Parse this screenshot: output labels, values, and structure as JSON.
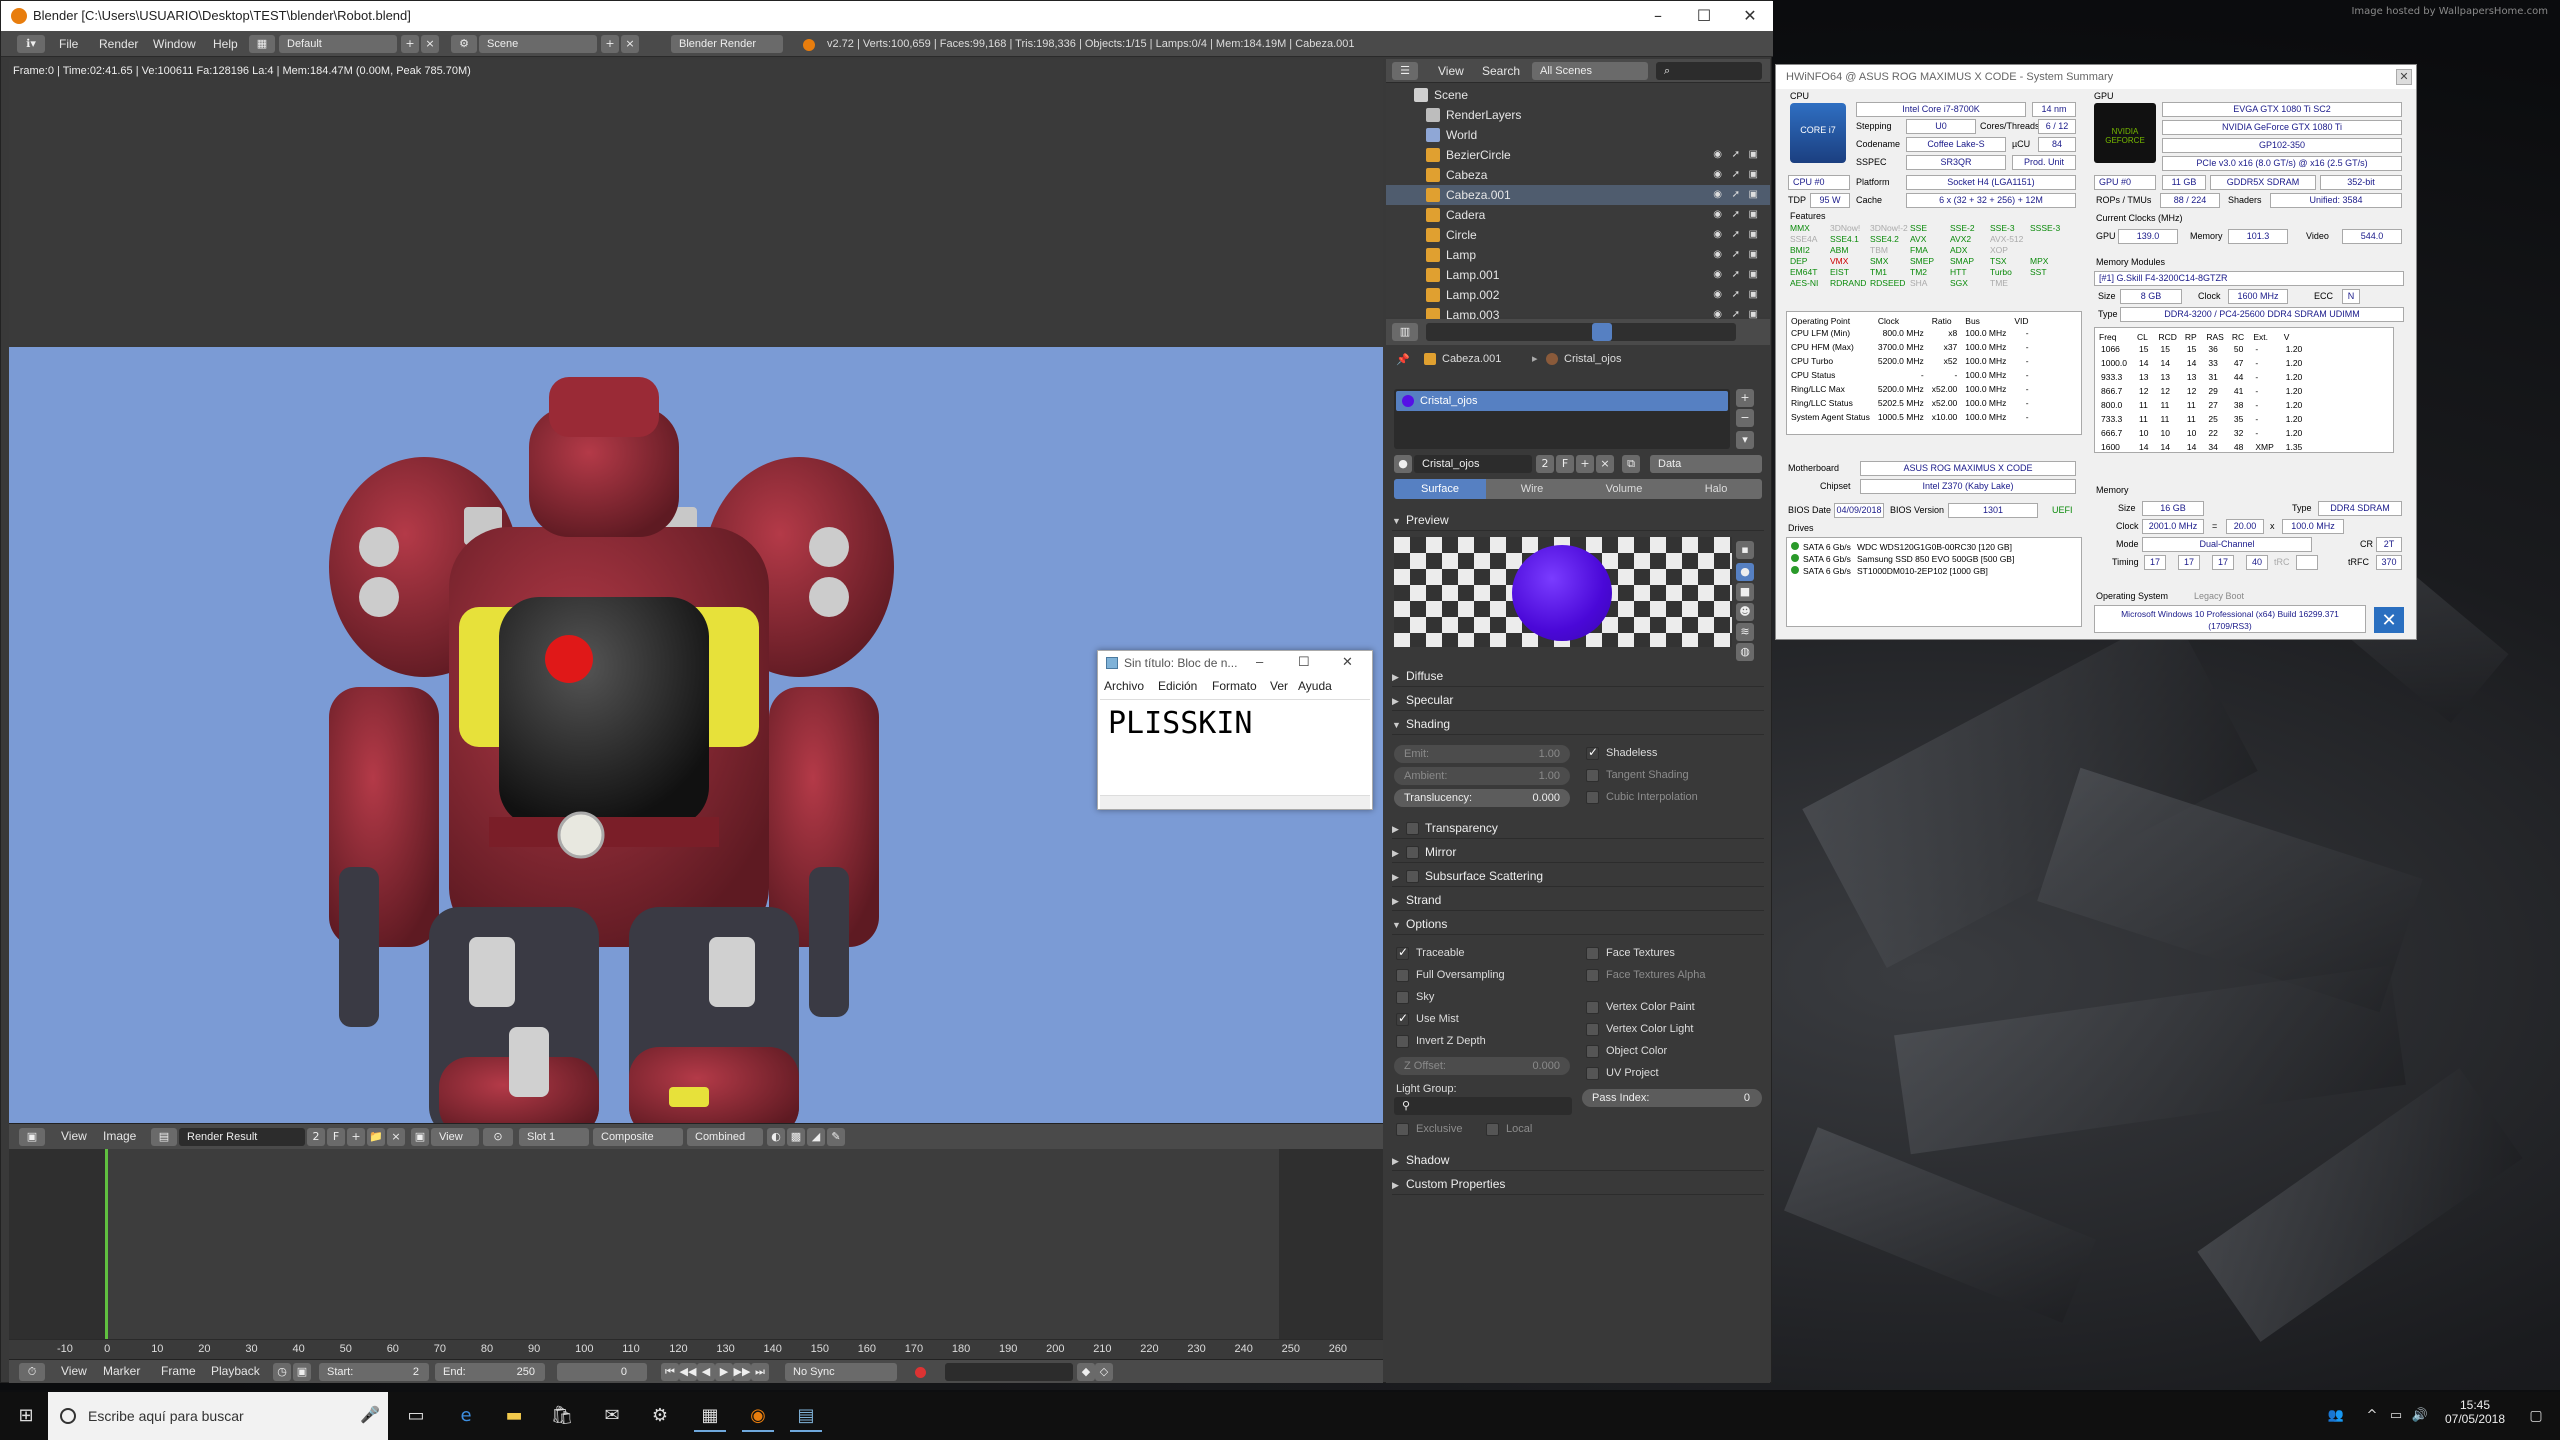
{
  "wallpaper": {
    "credit": "Image hosted by WallpapersHome.com"
  },
  "blender": {
    "title": "Blender [C:\\Users\\USUARIO\\Desktop\\TEST\\blender\\Robot.blend]",
    "menu": [
      "File",
      "Render",
      "Window",
      "Help"
    ],
    "layout": "Default",
    "scene": "Scene",
    "engine": "Blender Render",
    "stats": "v2.72 | Verts:100,659 | Faces:99,168 | Tris:198,336 | Objects:1/15 | Lamps:0/4 | Mem:184.19M | Cabeza.001",
    "render_info": "Frame:0 | Time:02:41.65 | Ve:100611 Fa:128196 La:4 | Mem:184.47M (0.00M, Peak 785.70M)",
    "image_editor": {
      "menu": [
        "View",
        "Image"
      ],
      "image_name": "Render Result",
      "users": "2",
      "fake": "F",
      "view": "View",
      "slot": "Slot 1",
      "layer": "Composite",
      "pass": "Combined"
    },
    "timeline": {
      "ticks": [
        "-10",
        "0",
        "10",
        "20",
        "30",
        "40",
        "50",
        "60",
        "70",
        "80",
        "90",
        "100",
        "110",
        "120",
        "130",
        "140",
        "150",
        "160",
        "170",
        "180",
        "190",
        "200",
        "210",
        "220",
        "230",
        "240",
        "250",
        "260"
      ],
      "menu": [
        "View",
        "Marker",
        "Frame",
        "Playback"
      ],
      "start_label": "Start:",
      "start": "2",
      "end_label": "End:",
      "end": "250",
      "current": "0",
      "sync": "No Sync"
    },
    "outliner": {
      "menu": [
        "View",
        "Search"
      ],
      "filter": "All Scenes",
      "items": [
        {
          "label": "Scene",
          "color": "#cfcfcf"
        },
        {
          "label": "RenderLayers",
          "color": "#bdbdbd"
        },
        {
          "label": "World",
          "color": "#8fa7d6"
        },
        {
          "label": "BezierCircle",
          "color": "#e0a030"
        },
        {
          "label": "Cabeza",
          "color": "#e0a030"
        },
        {
          "label": "Cabeza.001",
          "color": "#e0a030"
        },
        {
          "label": "Cadera",
          "color": "#e0a030"
        },
        {
          "label": "Circle",
          "color": "#e0a030"
        },
        {
          "label": "Lamp",
          "color": "#e0a030"
        },
        {
          "label": "Lamp.001",
          "color": "#e0a030"
        },
        {
          "label": "Lamp.002",
          "color": "#e0a030"
        },
        {
          "label": "Lamp.003",
          "color": "#e0a030"
        }
      ]
    },
    "properties": {
      "breadcrumb_object": "Cabeza.001",
      "breadcrumb_material": "Cristal_ojos",
      "slot_name": "Cristal_ojos",
      "material_name": "Cristal_ojos",
      "users": "2",
      "fake": "F",
      "link": "Data",
      "tabs": [
        "Surface",
        "Wire",
        "Volume",
        "Halo"
      ],
      "preview_label": "Preview",
      "preview_color": "#5510e6",
      "panels": {
        "diffuse": "Diffuse",
        "specular": "Specular",
        "shading": "Shading",
        "transparency": "Transparency",
        "mirror": "Mirror",
        "sss": "Subsurface Scattering",
        "strand": "Strand",
        "options": "Options",
        "shadow": "Shadow",
        "custom": "Custom Properties"
      },
      "shading": {
        "emit_label": "Emit:",
        "emit": "1.00",
        "ambient_label": "Ambient:",
        "ambient": "1.00",
        "translucency_label": "Translucency:",
        "translucency": "0.000",
        "shadeless": "Shadeless",
        "tangent": "Tangent Shading",
        "cubic": "Cubic Interpolation"
      },
      "options": {
        "traceable": "Traceable",
        "full_os": "Full Oversampling",
        "sky": "Sky",
        "use_mist": "Use Mist",
        "invert_z": "Invert Z Depth",
        "z_offset_label": "Z Offset:",
        "z_offset": "0.000",
        "light_group": "Light Group:",
        "exclusive": "Exclusive",
        "local": "Local",
        "face_textures": "Face Textures",
        "face_textures_alpha": "Face Textures Alpha",
        "vc_paint": "Vertex Color Paint",
        "vc_light": "Vertex Color Light",
        "object_color": "Object Color",
        "uv_project": "UV Project",
        "pass_index_label": "Pass Index:",
        "pass_index": "0"
      }
    }
  },
  "notepad": {
    "title": "Sin título: Bloc de n...",
    "menu": [
      "Archivo",
      "Edición",
      "Formato",
      "Ver",
      "Ayuda"
    ],
    "content": "PLISSKIN"
  },
  "hwinfo": {
    "title": "HWiNFO64 @ ASUS ROG MAXIMUS X CODE - System Summary",
    "cpu": {
      "label": "CPU",
      "name": "Intel Core i7-8700K",
      "nm": "14 nm",
      "stepping_label": "Stepping",
      "stepping": "U0",
      "cores_label": "Cores/Threads",
      "cores": "6 / 12",
      "codename_label": "Codename",
      "codename": "Coffee Lake-S",
      "ucu_label": "µCU",
      "ucu": "84",
      "sspec_label": "SSPEC",
      "sspec": "SR3QR",
      "prod_unit": "Prod. Unit",
      "platform_label": "Platform",
      "platform": "Socket H4 (LGA1151)",
      "select": "CPU #0",
      "tdp_label": "TDP",
      "tdp": "95 W",
      "cache_label": "Cache",
      "cache": "6 x (32 + 32 + 256) + 12M",
      "features_label": "Features",
      "badge": "CORE i7"
    },
    "features": [
      {
        "t": "MMX",
        "c": "g"
      },
      {
        "t": "3DNow!",
        "c": "x"
      },
      {
        "t": "3DNow!-2",
        "c": "x"
      },
      {
        "t": "SSE",
        "c": "g"
      },
      {
        "t": "SSE-2",
        "c": "g"
      },
      {
        "t": "SSE-3",
        "c": "g"
      },
      {
        "t": "SSSE-3",
        "c": "g"
      },
      {
        "t": "SSE4A",
        "c": "x"
      },
      {
        "t": "SSE4.1",
        "c": "g"
      },
      {
        "t": "SSE4.2",
        "c": "g"
      },
      {
        "t": "AVX",
        "c": "g"
      },
      {
        "t": "AVX2",
        "c": "g"
      },
      {
        "t": "AVX-512",
        "c": "x"
      },
      {
        "t": "",
        "c": "x"
      },
      {
        "t": "BMI2",
        "c": "g"
      },
      {
        "t": "ABM",
        "c": "g"
      },
      {
        "t": "TBM",
        "c": "x"
      },
      {
        "t": "FMA",
        "c": "g"
      },
      {
        "t": "ADX",
        "c": "g"
      },
      {
        "t": "XOP",
        "c": "x"
      },
      {
        "t": "",
        "c": "x"
      },
      {
        "t": "DEP",
        "c": "g"
      },
      {
        "t": "VMX",
        "c": "r"
      },
      {
        "t": "SMX",
        "c": "g"
      },
      {
        "t": "SMEP",
        "c": "g"
      },
      {
        "t": "SMAP",
        "c": "g"
      },
      {
        "t": "TSX",
        "c": "g"
      },
      {
        "t": "MPX",
        "c": "g"
      },
      {
        "t": "EM64T",
        "c": "g"
      },
      {
        "t": "EIST",
        "c": "g"
      },
      {
        "t": "TM1",
        "c": "g"
      },
      {
        "t": "TM2",
        "c": "g"
      },
      {
        "t": "HTT",
        "c": "g"
      },
      {
        "t": "Turbo",
        "c": "g"
      },
      {
        "t": "SST",
        "c": "g"
      },
      {
        "t": "AES-NI",
        "c": "g"
      },
      {
        "t": "RDRAND",
        "c": "g"
      },
      {
        "t": "RDSEED",
        "c": "g"
      },
      {
        "t": "SHA",
        "c": "x"
      },
      {
        "t": "SGX",
        "c": "g"
      },
      {
        "t": "TME",
        "c": "x"
      },
      {
        "t": "",
        "c": "x"
      }
    ],
    "op_table": {
      "headers": [
        "Operating Point",
        "Clock",
        "Ratio",
        "Bus",
        "VID"
      ],
      "rows": [
        [
          "CPU LFM (Min)",
          "800.0 MHz",
          "x8",
          "100.0 MHz",
          "-"
        ],
        [
          "CPU HFM (Max)",
          "3700.0 MHz",
          "x37",
          "100.0 MHz",
          "-"
        ],
        [
          "CPU Turbo",
          "5200.0 MHz",
          "x52",
          "100.0 MHz",
          "-"
        ],
        [
          "CPU Status",
          "-",
          "-",
          "100.0 MHz",
          "-"
        ],
        [
          "Ring/LLC Max",
          "5200.0 MHz",
          "x52.00",
          "100.0 MHz",
          "-"
        ],
        [
          "Ring/LLC Status",
          "5202.5 MHz",
          "x52.00",
          "100.0 MHz",
          "-"
        ],
        [
          "System Agent Status",
          "1000.5 MHz",
          "x10.00",
          "100.0 MHz",
          "-"
        ]
      ]
    },
    "mobo": {
      "label": "Motherboard",
      "value": "ASUS ROG MAXIMUS X CODE",
      "chipset_label": "Chipset",
      "chipset": "Intel Z370 (Kaby Lake)",
      "bios_date_label": "BIOS Date",
      "bios_date": "04/09/2018",
      "bios_ver_label": "BIOS Version",
      "bios_ver": "1301",
      "uefi": "UEFI"
    },
    "drives": {
      "label": "Drives",
      "items": [
        [
          "SATA 6 Gb/s",
          "WDC WDS120G1G0B-00RC30 [120 GB]"
        ],
        [
          "SATA 6 Gb/s",
          "Samsung SSD 850 EVO 500GB [500 GB]"
        ],
        [
          "SATA 6 Gb/s",
          "ST1000DM010-2EP102 [1000 GB]"
        ]
      ]
    },
    "gpu": {
      "label": "GPU",
      "name": "EVGA GTX 1080 Ti SC2",
      "chip": "NVIDIA GeForce GTX 1080 Ti",
      "code": "GP102-350",
      "pcie": "PCIe v3.0 x16 (8.0 GT/s) @ x16 (2.5 GT/s)",
      "select": "GPU #0",
      "vram": "11 GB",
      "vram_type": "GDDR5X SDRAM",
      "bus": "352-bit",
      "rops_label": "ROPs / TMUs",
      "rops": "88 / 224",
      "shaders_label": "Shaders",
      "shaders": "Unified: 3584",
      "clocks_label": "Current Clocks (MHz)",
      "gpu_clk_label": "GPU",
      "gpu_clk": "139.0",
      "mem_clk_label": "Memory",
      "mem_clk": "101.3",
      "video_clk_label": "Video",
      "video_clk": "544.0",
      "logo": "NVIDIA GEFORCE"
    },
    "memmod": {
      "label": "Memory Modules",
      "select": "[#1] G.Skill F4-3200C14-8GTZR",
      "size_label": "Size",
      "size": "8 GB",
      "clock_label": "Clock",
      "clock": "1600 MHz",
      "ecc_label": "ECC",
      "ecc": "N",
      "type_label": "Type",
      "type": "DDR4-3200 / PC4-25600 DDR4 SDRAM UDIMM",
      "timing_headers": [
        "Freq",
        "CL",
        "RCD",
        "RP",
        "RAS",
        "RC",
        "Ext.",
        "V"
      ],
      "timing_rows": [
        [
          "1066",
          "15",
          "15",
          "15",
          "36",
          "50",
          "-",
          "1.20"
        ],
        [
          "1000.0",
          "14",
          "14",
          "14",
          "33",
          "47",
          "-",
          "1.20"
        ],
        [
          "933.3",
          "13",
          "13",
          "13",
          "31",
          "44",
          "-",
          "1.20"
        ],
        [
          "866.7",
          "12",
          "12",
          "12",
          "29",
          "41",
          "-",
          "1.20"
        ],
        [
          "800.0",
          "11",
          "11",
          "11",
          "27",
          "38",
          "-",
          "1.20"
        ],
        [
          "733.3",
          "11",
          "11",
          "11",
          "25",
          "35",
          "-",
          "1.20"
        ],
        [
          "666.7",
          "10",
          "10",
          "10",
          "22",
          "32",
          "-",
          "1.20"
        ],
        [
          "1600",
          "14",
          "14",
          "14",
          "34",
          "48",
          "XMP",
          "1.35"
        ]
      ]
    },
    "memory": {
      "label": "Memory",
      "size_label": "Size",
      "size": "16 GB",
      "type_label": "Type",
      "type": "DDR4 SDRAM",
      "clock_label": "Clock",
      "clock": "2001.0 MHz",
      "eq": "=",
      "mult": "20.00",
      "x": "x",
      "bus": "100.0 MHz",
      "mode_label": "Mode",
      "mode": "Dual-Channel",
      "cr_label": "CR",
      "cr": "2T",
      "timing_label": "Timing",
      "timings": [
        "17",
        "17",
        "17",
        "40"
      ],
      "trc_label": "tRC",
      "trfc_label": "tRFC",
      "trfc": "370"
    },
    "os": {
      "label": "Operating System",
      "boot": "Legacy Boot",
      "value": "Microsoft Windows 10 Professional (x64) Build 16299.371 (1709/RS3)"
    }
  },
  "taskbar": {
    "search_placeholder": "Escribe aquí para buscar",
    "time": "15:45",
    "date": "07/05/2018"
  }
}
